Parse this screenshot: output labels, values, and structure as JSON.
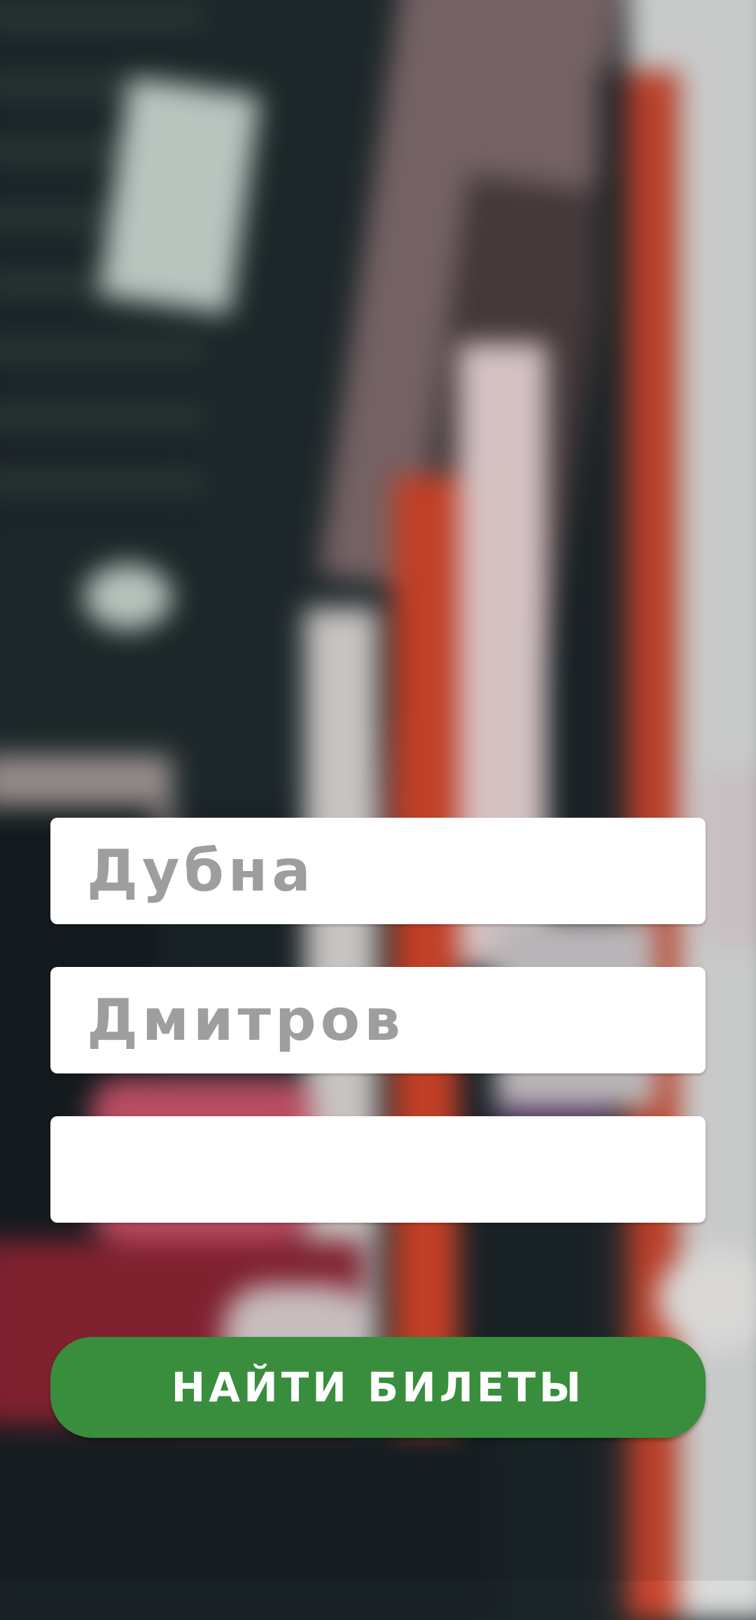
{
  "search_form": {
    "from_value": "Дубна",
    "to_value": "Дмитров",
    "date_value": "",
    "submit_label": "НАЙТИ БИЛЕТЫ"
  },
  "colors": {
    "button": "#388e3c",
    "field_text": "#9e9e9e",
    "field_background": "#ffffff"
  },
  "icons": {
    "background": "blurred-bus-interior-photo"
  }
}
